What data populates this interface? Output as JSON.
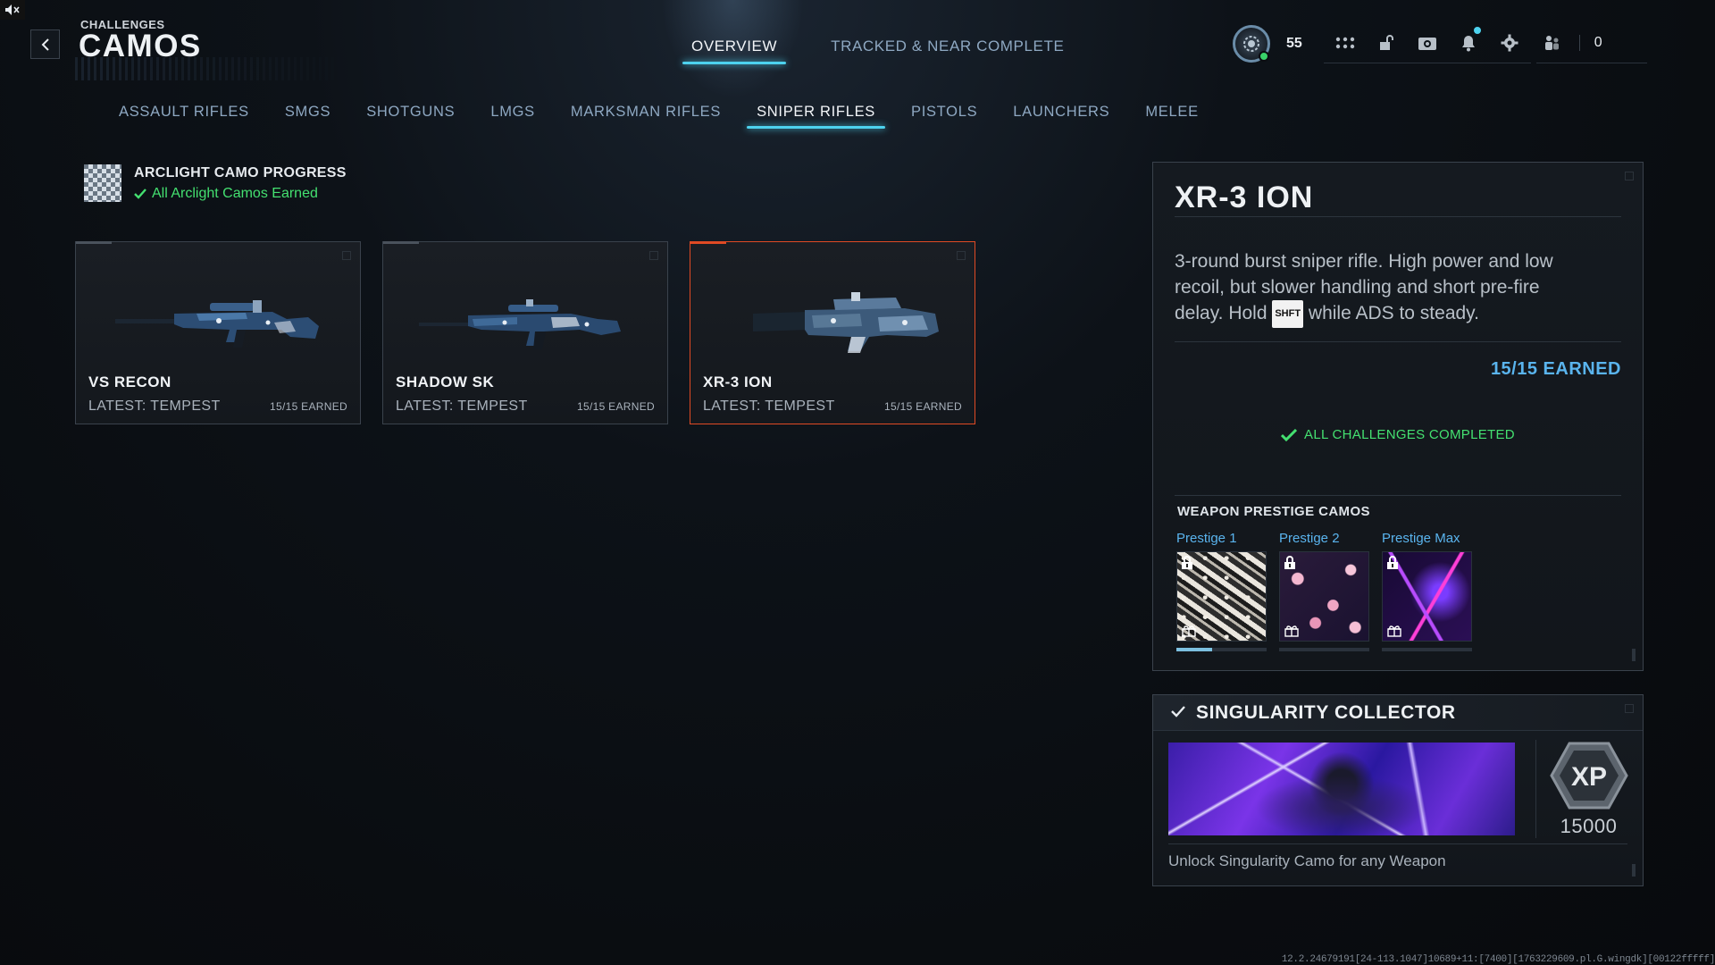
{
  "header": {
    "breadcrumb": "CHALLENGES",
    "title": "CAMOS",
    "tabs": [
      {
        "label": "OVERVIEW",
        "active": true
      },
      {
        "label": "TRACKED & NEAR COMPLETE",
        "active": false
      }
    ],
    "player_level": "55",
    "friends_online": "0"
  },
  "categories": [
    {
      "label": "ASSAULT RIFLES",
      "active": false
    },
    {
      "label": "SMGS",
      "active": false
    },
    {
      "label": "SHOTGUNS",
      "active": false
    },
    {
      "label": "LMGS",
      "active": false
    },
    {
      "label": "MARKSMAN RIFLES",
      "active": false
    },
    {
      "label": "SNIPER RIFLES",
      "active": true
    },
    {
      "label": "PISTOLS",
      "active": false
    },
    {
      "label": "LAUNCHERS",
      "active": false
    },
    {
      "label": "MELEE",
      "active": false
    }
  ],
  "arclight": {
    "title": "ARCLIGHT CAMO PROGRESS",
    "status": "All Arclight Camos Earned"
  },
  "weapons": [
    {
      "name": "VS RECON",
      "latest": "LATEST: TEMPEST",
      "earned": "15/15 EARNED",
      "selected": false
    },
    {
      "name": "SHADOW SK",
      "latest": "LATEST: TEMPEST",
      "earned": "15/15 EARNED",
      "selected": false
    },
    {
      "name": "XR-3 ION",
      "latest": "LATEST: TEMPEST",
      "earned": "15/15 EARNED",
      "selected": true
    }
  ],
  "detail": {
    "title": "XR-3 ION",
    "desc_before_key": "3-round burst sniper rifle. High power and low recoil, but slower handling and short pre-fire delay. Hold ",
    "key": "SHFT",
    "desc_after_key": " while ADS to steady.",
    "earned": "15/15 EARNED",
    "completed": "ALL CHALLENGES COMPLETED",
    "prestige_title": "WEAPON PRESTIGE CAMOS",
    "prestige": [
      {
        "label": "Prestige 1",
        "progress": 0.4
      },
      {
        "label": "Prestige 2",
        "progress": 0
      },
      {
        "label": "Prestige Max",
        "progress": 0
      }
    ]
  },
  "reward": {
    "title": "SINGULARITY COLLECTOR",
    "xp": "15000",
    "xp_label": "XP",
    "description": "Unlock Singularity Camo for any Weapon"
  },
  "build_info": "12.2.24679191[24-113.1047]10689+11:[7400][1763229609.pl.G.wingdk][00122fffff]",
  "colors": {
    "accent": "#4dd2ee",
    "earned_blue": "#5ab4ee",
    "complete_green": "#44e070",
    "selected_border": "#e04a24"
  }
}
